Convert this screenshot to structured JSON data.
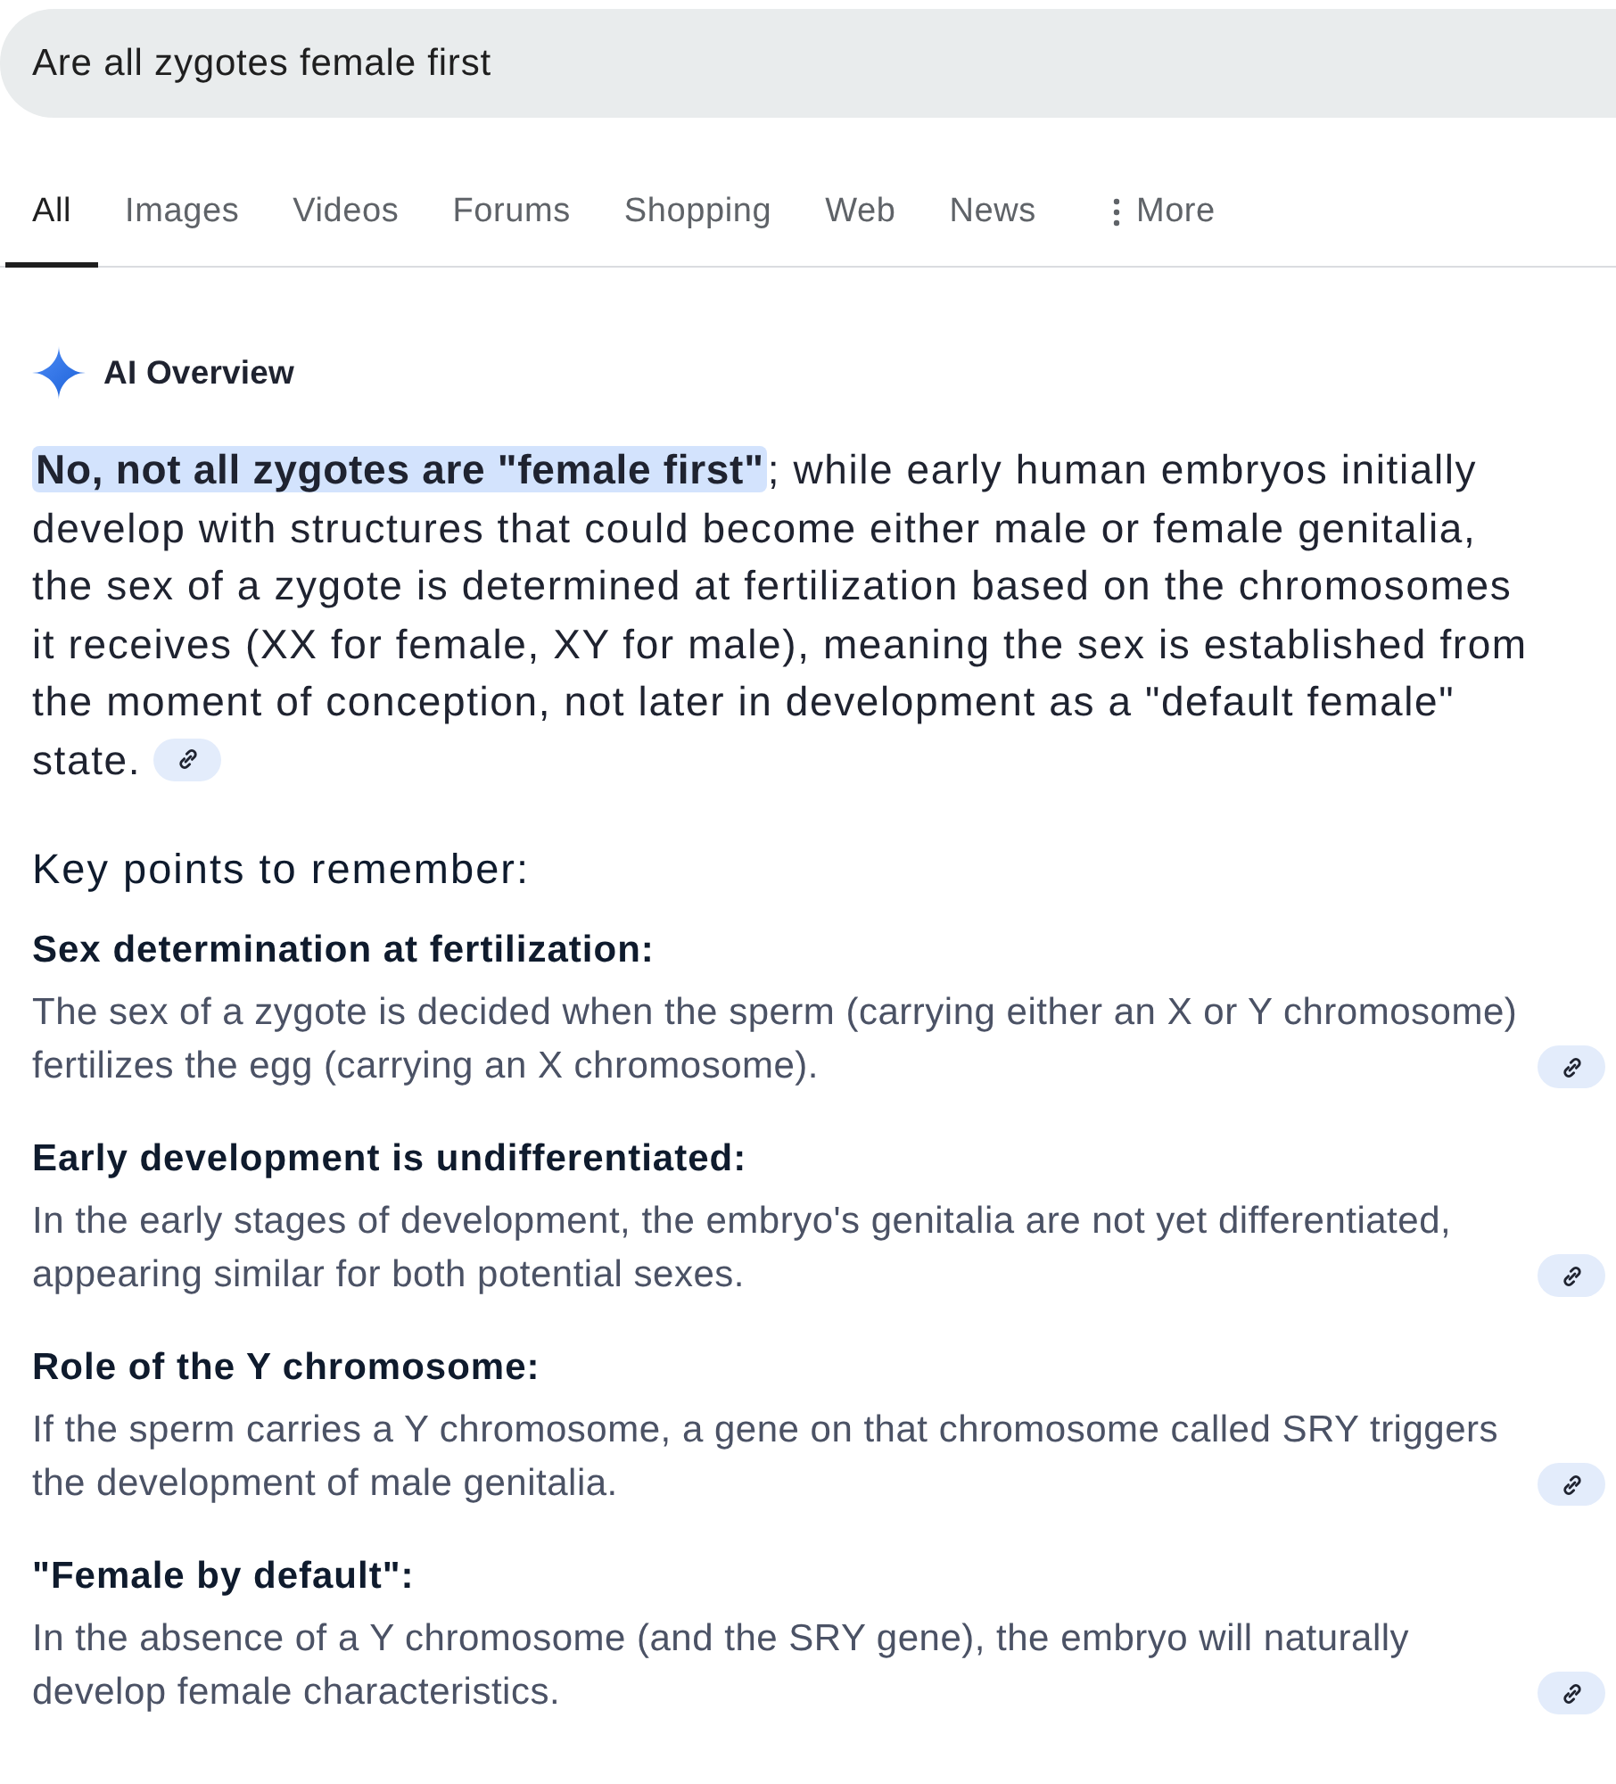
{
  "search": {
    "value": "Are all zygotes female first"
  },
  "tabs": [
    {
      "label": "All",
      "selected": true,
      "kind": "tab"
    },
    {
      "label": "Images",
      "selected": false,
      "kind": "tab"
    },
    {
      "label": "Videos",
      "selected": false,
      "kind": "tab"
    },
    {
      "label": "Forums",
      "selected": false,
      "kind": "tab"
    },
    {
      "label": "Shopping",
      "selected": false,
      "kind": "tab"
    },
    {
      "label": "Web",
      "selected": false,
      "kind": "tab"
    },
    {
      "label": "News",
      "selected": false,
      "kind": "tab"
    },
    {
      "label": "More",
      "selected": false,
      "kind": "more"
    }
  ],
  "ai_overview": {
    "title": "AI Overview",
    "summary": {
      "highlight": "No, not all zygotes are \"female first\"",
      "text": "; while early human embryos initially develop with structures that could become either male or female genitalia, the sex of a zygote is determined at fertilization based on the chromosomes it receives (XX for female, XY for male), meaning the sex is established from the moment of conception, not later in development as a \"default female\" state."
    },
    "key_points_heading": "Key points to remember:",
    "key_points": [
      {
        "title": "Sex determination at fertilization:",
        "text": "The sex of a zygote is decided when the sperm (carrying either an X or Y chromosome) fertilizes the egg (carrying an X chromosome)."
      },
      {
        "title": "Early development is undifferentiated:",
        "text": "In the early stages of development, the embryo's genitalia are not yet differentiated, appearing similar for both potential sexes."
      },
      {
        "title": "Role of the Y chromosome:",
        "text": "If the sperm carries a Y chromosome, a gene on that chromosome called SRY triggers the development of male genitalia."
      },
      {
        "title": "\"Female by default\":",
        "text": "In the absence of a Y chromosome (and the SRY gene), the embryo will naturally develop female characteristics."
      }
    ]
  }
}
